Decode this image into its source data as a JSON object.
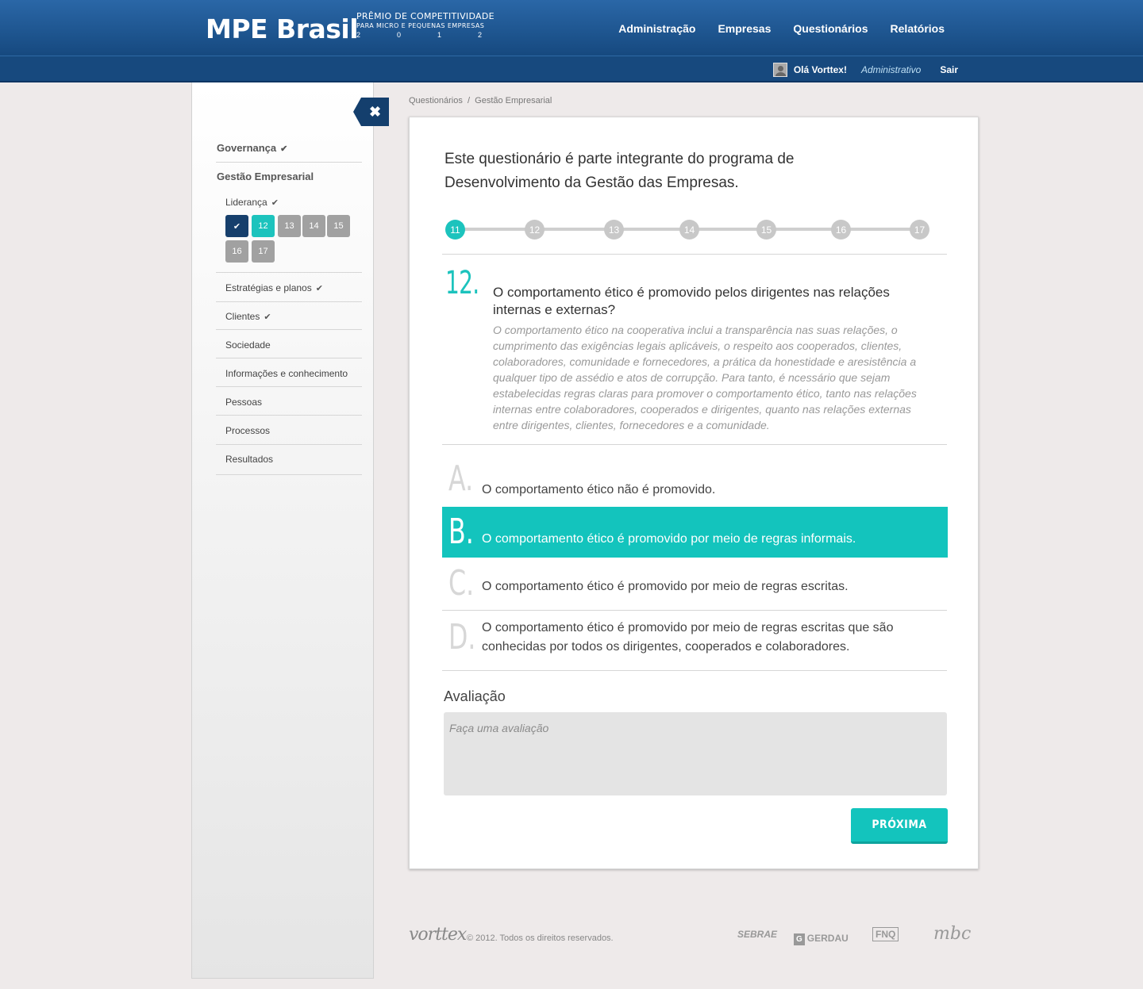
{
  "header": {
    "logo": "MPE Brasil",
    "subtitle1": "PRÊMIO DE COMPETITIVIDADE",
    "subtitle2": "PARA MICRO E PEQUENAS EMPRESAS",
    "year_digits": [
      "2",
      "0",
      "1",
      "2"
    ],
    "nav": [
      "Administração",
      "Empresas",
      "Questionários",
      "Relatórios"
    ]
  },
  "user": {
    "greeting": "Olá  Vorttex!",
    "role": "Administrativo",
    "logout": "Sair"
  },
  "sidebar": {
    "close_icon": "close-icon",
    "sections": [
      {
        "label": "Governança",
        "done": true
      },
      {
        "label": "Gestão Empresarial",
        "done": false
      }
    ],
    "lideranca": {
      "label": "Liderança",
      "done": true
    },
    "question_pills": [
      "✔",
      "12",
      "13",
      "14",
      "15",
      "16",
      "17"
    ],
    "items": [
      {
        "label": "Estratégias e planos",
        "done": true
      },
      {
        "label": "Clientes",
        "done": true
      },
      {
        "label": "Sociedade",
        "done": false
      },
      {
        "label": "Informações e conhecimento",
        "done": false
      },
      {
        "label": "Pessoas",
        "done": false
      },
      {
        "label": "Processos",
        "done": false
      },
      {
        "label": "Resultados",
        "done": false
      }
    ]
  },
  "breadcrumb": "Questionários  /  Gestão Empresarial",
  "intro": "Este questionário é parte integrante do programa de Desenvolvimento da Gestão das Empresas.",
  "progress": {
    "steps": [
      "11",
      "12",
      "13",
      "14",
      "15",
      "16",
      "17"
    ],
    "current": "11"
  },
  "question": {
    "number": "12.",
    "title": "O comportamento ético é promovido pelos dirigentes nas relações internas e externas?",
    "description": "O comportamento ético na cooperativa inclui a transparência nas suas relações, o cumprimento das exigências legais aplicáveis, o respeito aos cooperados, clientes, colaboradores, comunidade e fornecedores, a prática da honestidade e aresistência a qualquer tipo de assédio e atos de corrupção. Para tanto, é ncessário que sejam estabelecidas regras claras para promover o comportamento ético, tanto nas relações internas entre colaboradores, cooperados e dirigentes, quanto nas relações externas entre dirigentes, clientes, fornecedores e a comunidade."
  },
  "options": [
    {
      "letter": "A.",
      "text": "O comportamento ético não é promovido.",
      "selected": false
    },
    {
      "letter": "B.",
      "text": "O comportamento ético é promovido por meio de regras informais.",
      "selected": true
    },
    {
      "letter": "C.",
      "text": "O comportamento ético é promovido por meio de regras escritas.",
      "selected": false
    },
    {
      "letter": "D.",
      "text": "O comportamento ético é promovido por meio de regras escritas que são conhecidas por todos os dirigentes, cooperados e colaboradores.",
      "selected": false
    }
  ],
  "evaluation": {
    "label": "Avaliação",
    "placeholder": "Faça uma avaliação",
    "value": ""
  },
  "next_button": "PRÓXIMA",
  "footer": {
    "brand": "vorttex",
    "copyright": "© 2012. Todos os direitos reservados.",
    "partners": [
      "SEBRAE",
      "GERDAU",
      "FNQ",
      "mbc"
    ]
  },
  "colors": {
    "header": "#1f5a96",
    "accent": "#1cc3bd",
    "dark": "#163f6c"
  }
}
